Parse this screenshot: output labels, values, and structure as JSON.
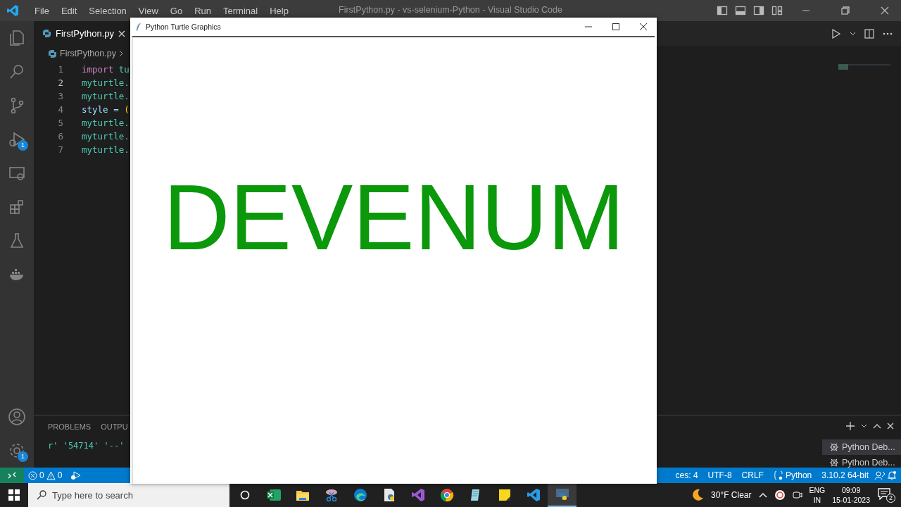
{
  "window": {
    "title": "FirstPython.py - vs-selenium-Python - Visual Studio Code"
  },
  "menu": [
    "File",
    "Edit",
    "Selection",
    "View",
    "Go",
    "Run",
    "Terminal",
    "Help"
  ],
  "activity_bar": {
    "run_debug_badge": "1",
    "manage_badge": "1"
  },
  "tabs": [
    {
      "label": "FirstPython.py",
      "selected": true
    }
  ],
  "breadcrumb": [
    "FirstPython.py"
  ],
  "code_lines": [
    {
      "number": "1",
      "current": false,
      "tokens": [
        {
          "text": "import",
          "kind": "keyword"
        },
        {
          "text": " tu",
          "kind": "module"
        }
      ]
    },
    {
      "number": "2",
      "current": true,
      "tokens": [
        {
          "text": "myturtle.",
          "kind": "object"
        }
      ]
    },
    {
      "number": "3",
      "current": false,
      "tokens": [
        {
          "text": "myturtle.",
          "kind": "object"
        }
      ]
    },
    {
      "number": "4",
      "current": false,
      "tokens": [
        {
          "text": "style = ",
          "kind": "variable"
        },
        {
          "text": "(",
          "kind": "bracket"
        }
      ]
    },
    {
      "number": "5",
      "current": false,
      "tokens": [
        {
          "text": "myturtle.",
          "kind": "object"
        }
      ]
    },
    {
      "number": "6",
      "current": false,
      "tokens": [
        {
          "text": "myturtle.",
          "kind": "object"
        }
      ]
    },
    {
      "number": "7",
      "current": false,
      "tokens": [
        {
          "text": "myturtle.",
          "kind": "object"
        }
      ]
    }
  ],
  "panel": {
    "tabs": [
      {
        "label": "PROBLEMS",
        "selected": false
      },
      {
        "label": "OUTPU",
        "selected": false
      }
    ],
    "output": "r' '54714' '--'",
    "terminals": [
      {
        "label": "Python Deb...",
        "selected": true
      },
      {
        "label": "Python Deb...",
        "selected": false
      }
    ]
  },
  "status_bar": {
    "errors": "0",
    "warnings": "0",
    "right": [
      "ces: 4",
      "UTF-8",
      "CRLF",
      "Python",
      "3.10.2 64-bit"
    ]
  },
  "turtle_window": {
    "title": "Python Turtle Graphics",
    "text": "DEVENUM"
  },
  "taskbar": {
    "search_placeholder": "Type here to search",
    "apps": [
      {
        "active": false
      },
      {
        "active": false
      },
      {
        "active": false
      },
      {
        "active": false
      },
      {
        "active": false
      },
      {
        "active": false
      },
      {
        "active": false
      },
      {
        "active": false
      },
      {
        "active": false
      },
      {
        "active": false
      },
      {
        "active": true
      }
    ],
    "weather": "30°F Clear",
    "language": [
      "ENG",
      "IN"
    ],
    "time": "09:09",
    "date": "15-01-2023",
    "notifications": "2"
  }
}
